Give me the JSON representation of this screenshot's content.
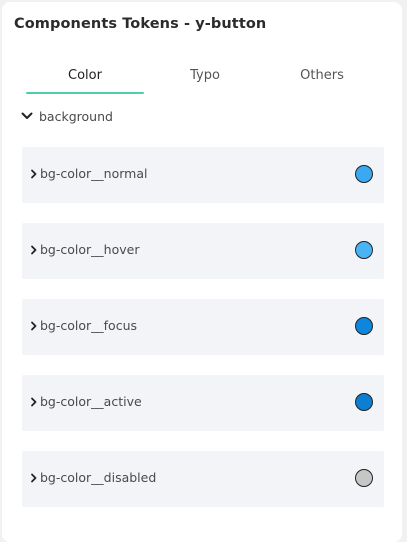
{
  "panel": {
    "title": "Components Tokens - y-button"
  },
  "tabs": [
    {
      "label": "Color",
      "active": true
    },
    {
      "label": "Typo",
      "active": false
    },
    {
      "label": "Others",
      "active": false
    }
  ],
  "group": {
    "label": "background",
    "expanded": true,
    "icon": "chevron-down-icon"
  },
  "tokens": [
    {
      "name": "bg-color__normal",
      "color": "#3aa9f2"
    },
    {
      "name": "bg-color__hover",
      "color": "#4ab3f4"
    },
    {
      "name": "bg-color__focus",
      "color": "#0d86dc"
    },
    {
      "name": "bg-color__active",
      "color": "#0c7fd2"
    },
    {
      "name": "bg-color__disabled",
      "color": "#c6c6c6"
    }
  ],
  "accent_color": "#4ccfa8"
}
